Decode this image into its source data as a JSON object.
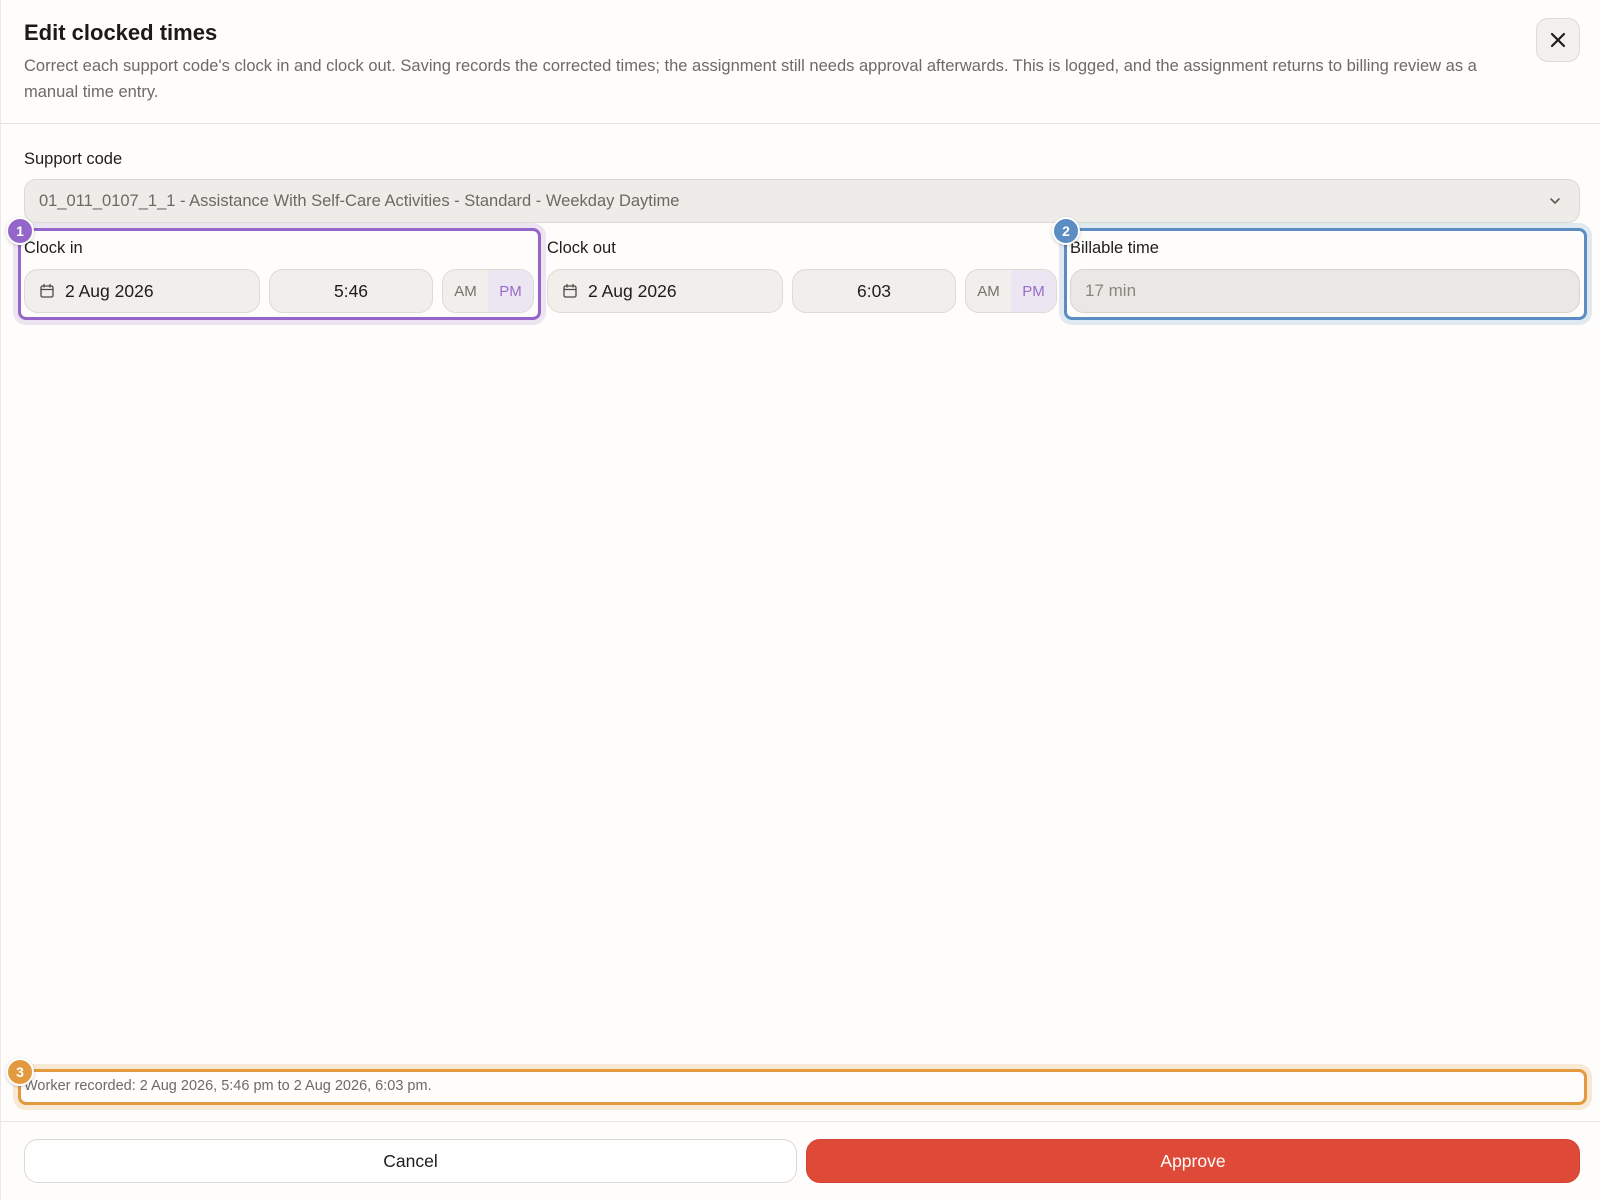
{
  "dialog": {
    "title": "Edit clocked times",
    "subtitle": "Correct each support code's clock in and clock out. Saving records the corrected times; the assignment still needs approval afterwards. This is logged, and the assignment returns to billing review as a manual time entry."
  },
  "support_code": {
    "label": "Support code",
    "selected": "01_011_0107_1_1 - Assistance With Self-Care Activities - Standard - Weekday Daytime"
  },
  "clock_in": {
    "label": "Clock in",
    "date": "2 Aug 2026",
    "time": "5:46",
    "am_label": "AM",
    "pm_label": "PM",
    "selected_period": "PM"
  },
  "clock_out": {
    "label": "Clock out",
    "date": "2 Aug 2026",
    "time": "6:03",
    "am_label": "AM",
    "pm_label": "PM",
    "selected_period": "PM"
  },
  "billable": {
    "label": "Billable time",
    "value": "17 min"
  },
  "worker_note": "Worker recorded: 2 Aug 2026, 5:46 pm to 2 Aug 2026, 6:03 pm.",
  "badges": [
    "1",
    "2",
    "3"
  ],
  "actions": {
    "cancel_label": "Cancel",
    "approve_label": "Approve"
  },
  "colors": {
    "accent_purple": "#9466c9",
    "accent_blue": "#5b8cc2",
    "accent_orange": "#e39a3e",
    "approve_red": "#de4a37"
  }
}
